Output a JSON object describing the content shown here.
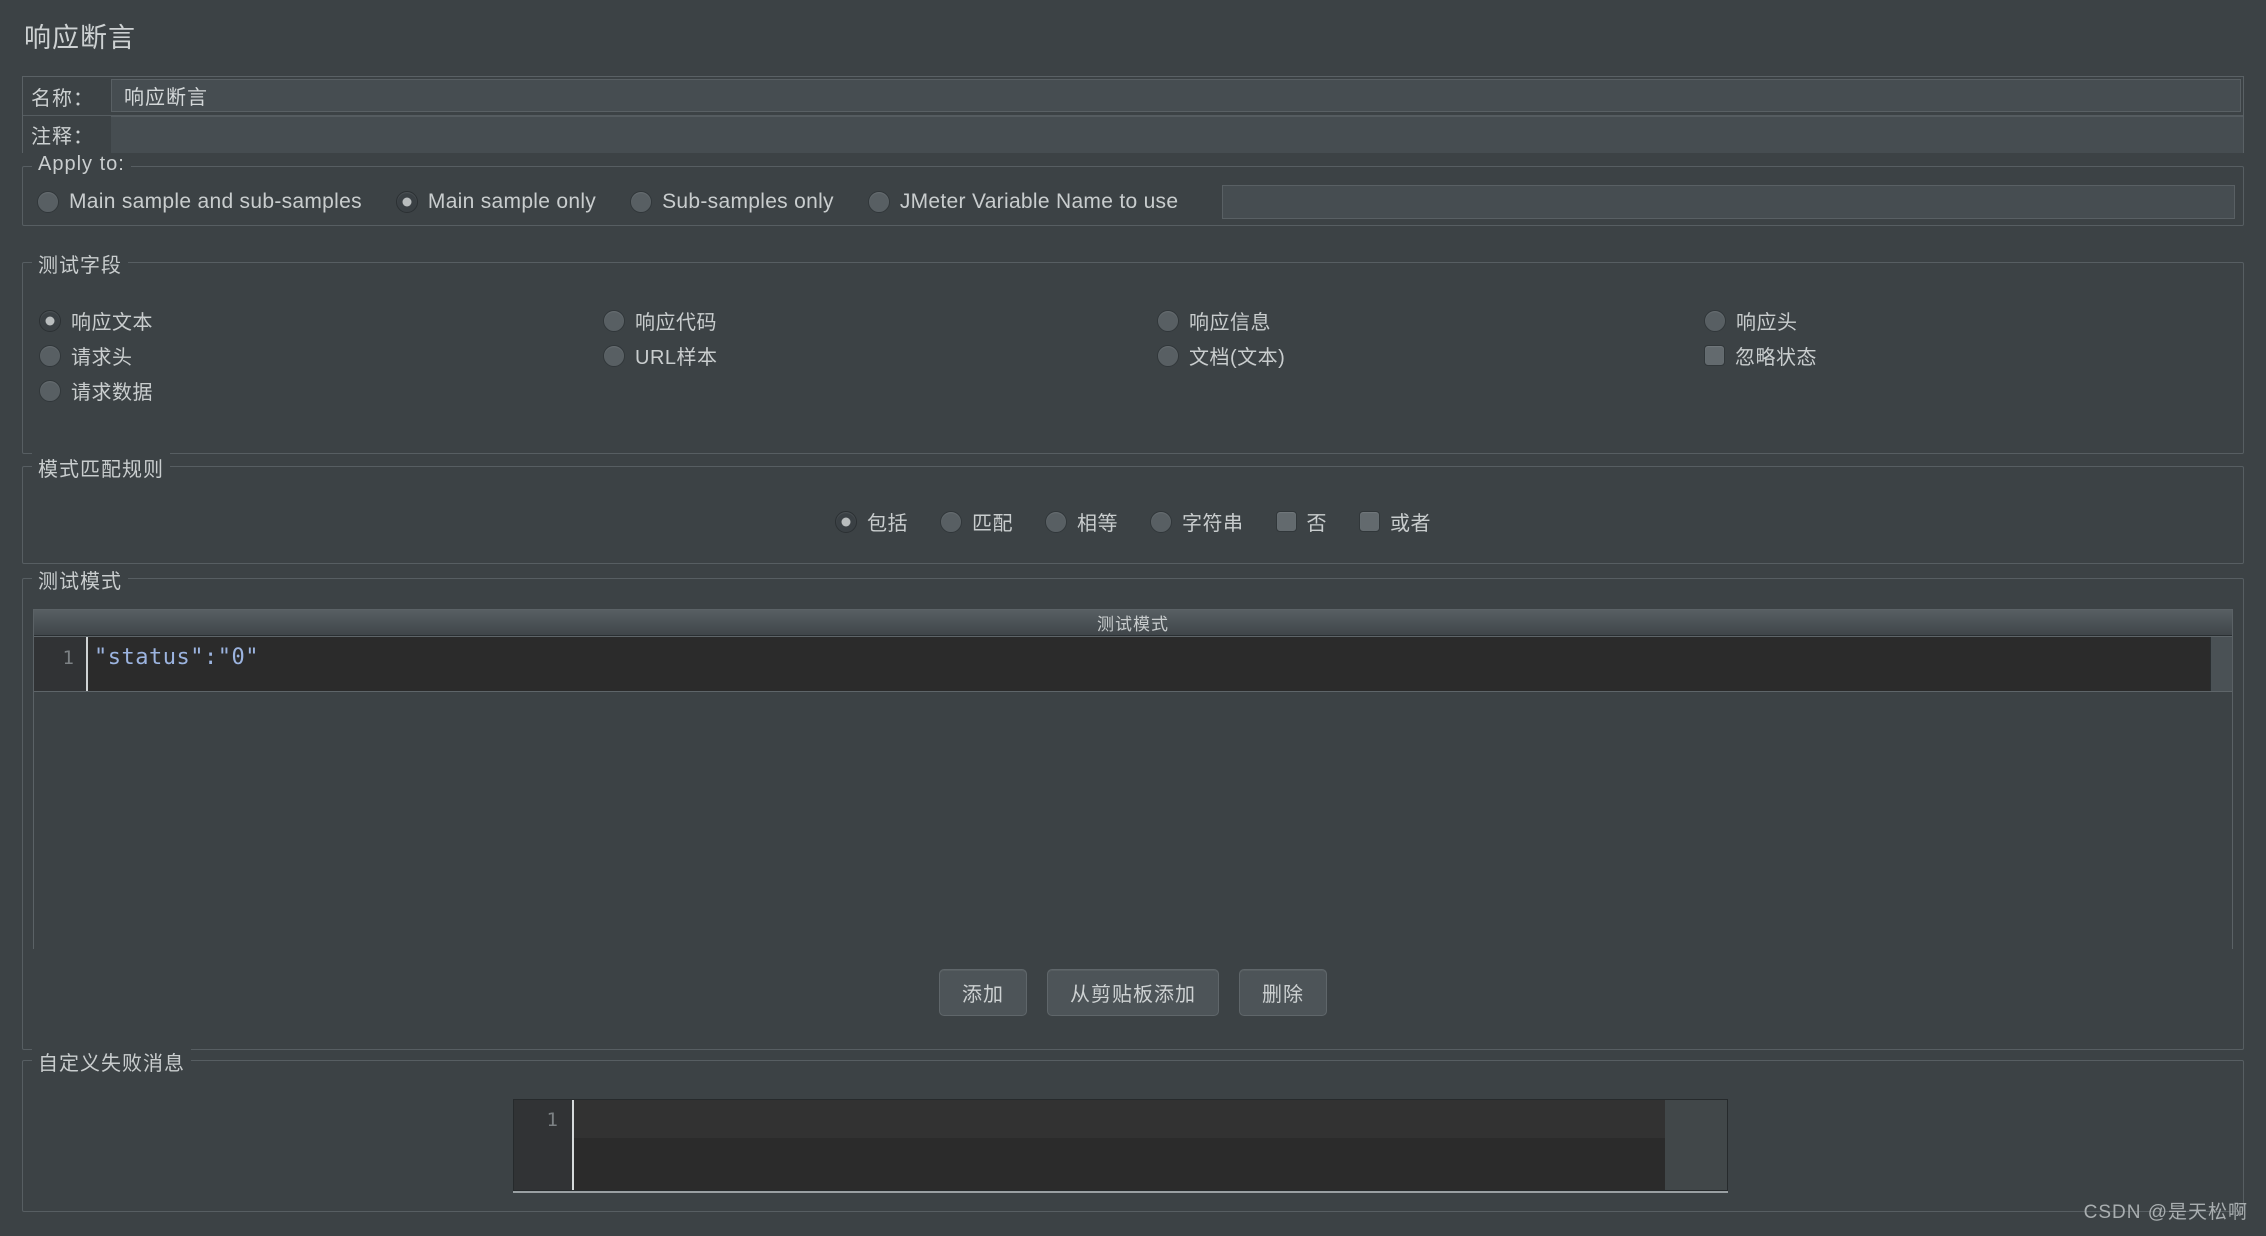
{
  "window": {
    "title": "响应断言",
    "watermark": "CSDN @是天松啊"
  },
  "fields": {
    "name_label": "名称：",
    "name_value": "响应断言",
    "comment_label": "注释：",
    "comment_value": ""
  },
  "apply_to": {
    "legend": "Apply to:",
    "options": [
      {
        "label": "Main sample and sub-samples",
        "selected": false
      },
      {
        "label": "Main sample only",
        "selected": true
      },
      {
        "label": "Sub-samples only",
        "selected": false
      },
      {
        "label": "JMeter Variable Name to use",
        "selected": false
      }
    ],
    "variable_value": ""
  },
  "test_field": {
    "legend": "测试字段",
    "items": [
      {
        "label": "响应文本",
        "type": "radio",
        "selected": true
      },
      {
        "label": "响应代码",
        "type": "radio",
        "selected": false
      },
      {
        "label": "响应信息",
        "type": "radio",
        "selected": false
      },
      {
        "label": "响应头",
        "type": "radio",
        "selected": false
      },
      {
        "label": "请求头",
        "type": "radio",
        "selected": false
      },
      {
        "label": "URL样本",
        "type": "radio",
        "selected": false
      },
      {
        "label": "文档(文本)",
        "type": "radio",
        "selected": false
      },
      {
        "label": "忽略状态",
        "type": "checkbox",
        "selected": false
      },
      {
        "label": "请求数据",
        "type": "radio",
        "selected": false
      }
    ]
  },
  "match_rule": {
    "legend": "模式匹配规则",
    "items": [
      {
        "label": "包括",
        "type": "radio",
        "selected": true
      },
      {
        "label": "匹配",
        "type": "radio",
        "selected": false
      },
      {
        "label": "相等",
        "type": "radio",
        "selected": false
      },
      {
        "label": "字符串",
        "type": "radio",
        "selected": false
      },
      {
        "label": "否",
        "type": "checkbox",
        "selected": false
      },
      {
        "label": "或者",
        "type": "checkbox",
        "selected": false
      }
    ]
  },
  "test_pattern": {
    "legend": "测试模式",
    "column_header": "测试模式",
    "rows": [
      {
        "line_number": "1",
        "value": "\"status\":\"0\""
      }
    ],
    "buttons": [
      {
        "label": "添加",
        "name": "add-button"
      },
      {
        "label": "从剪贴板添加",
        "name": "add-from-clipboard-button"
      },
      {
        "label": "删除",
        "name": "delete-button"
      }
    ]
  },
  "failure_message": {
    "legend": "自定义失败消息",
    "line_number": "1",
    "value": ""
  }
}
